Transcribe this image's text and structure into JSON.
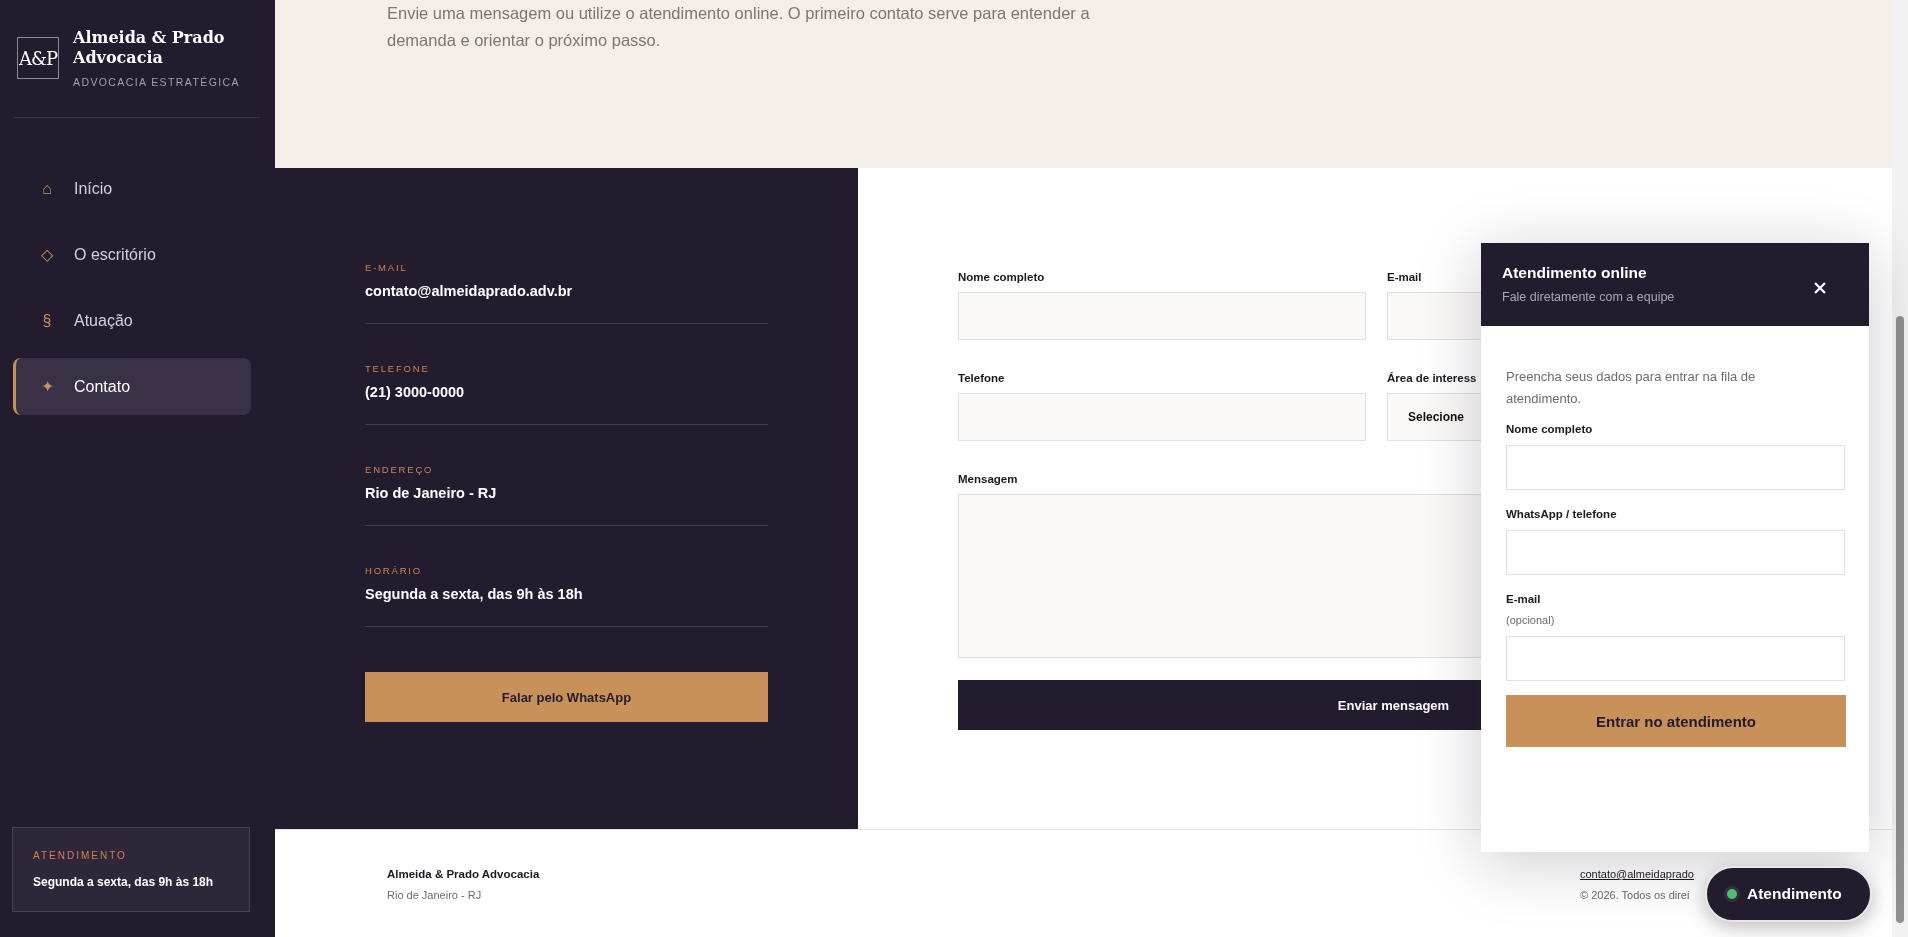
{
  "sidebar": {
    "logo": "A&P",
    "brand": "Almeida & Prado Advocacia",
    "tagline": "ADVOCACIA ESTRATÉGICA",
    "nav": [
      {
        "icon": "⌂",
        "label": "Início",
        "selected": false
      },
      {
        "icon": "◇",
        "label": "O escritório",
        "selected": false
      },
      {
        "icon": "§",
        "label": "Atuação",
        "selected": false
      },
      {
        "icon": "✦",
        "label": "Contato",
        "selected": true
      }
    ],
    "hours_card": {
      "label": "ATENDIMENTO",
      "text": "Segunda a sexta, das 9h às 18h"
    }
  },
  "intro": {
    "text": "Envie uma mensagem ou utilize o atendimento online. O primeiro contato serve para entender a demanda e orientar o próximo passo."
  },
  "contact_info": {
    "items": [
      {
        "label": "E-MAIL",
        "value": "contato@almeidaprado.adv.br"
      },
      {
        "label": "TELEFONE",
        "value": "(21) 3000-0000"
      },
      {
        "label": "ENDEREÇO",
        "value": "Rio de Janeiro - RJ"
      },
      {
        "label": "HORÁRIO",
        "value": "Segunda a sexta, das 9h às 18h"
      }
    ],
    "button": "Falar pelo WhatsApp"
  },
  "form": {
    "fields": [
      {
        "kind": "text",
        "label": "Nome completo"
      },
      {
        "kind": "text",
        "label": "E-mail"
      },
      {
        "kind": "text",
        "label": "Telefone"
      },
      {
        "kind": "select",
        "label": "Área de interess",
        "value": "Selecione"
      },
      {
        "kind": "textarea",
        "label": "Mensagem"
      }
    ],
    "submit": "Enviar mensagem"
  },
  "chat_widget": {
    "title": "Atendimento online",
    "subtitle": "Fale diretamente com a equipe",
    "intro": "Preencha seus dados para entrar na fila de atendimento.",
    "fields": [
      {
        "label": "Nome completo"
      },
      {
        "label": "WhatsApp / telefone"
      },
      {
        "label": "E-mail",
        "hint": "(opcional)"
      }
    ],
    "submit": "Entrar no atendimento"
  },
  "footer": {
    "name": "Almeida & Prado Advocacia",
    "city": "Rio de Janeiro - RJ",
    "email": "contato@almeidaprado",
    "copyright": "© 2026. Todos os direi"
  },
  "chat_launcher": {
    "label": "Atendimento",
    "online": true
  }
}
